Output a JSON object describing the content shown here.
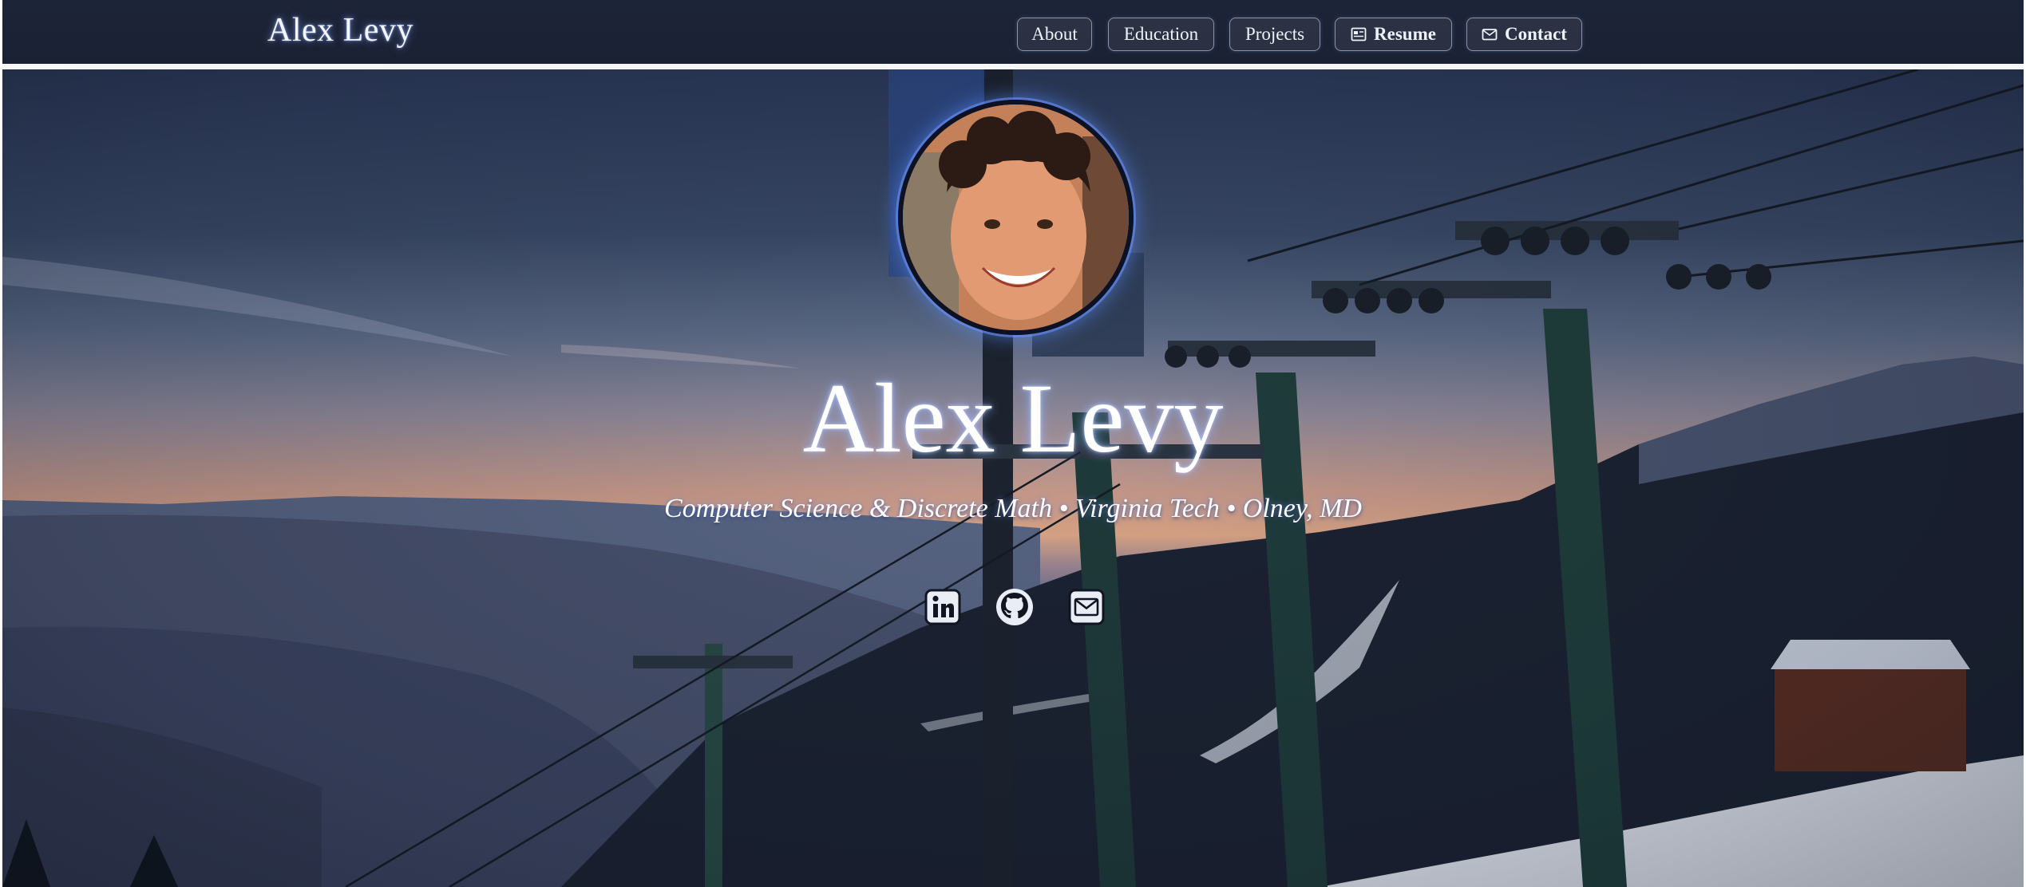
{
  "nav": {
    "brand": "Alex Levy",
    "links": [
      {
        "label": "About",
        "icon": null
      },
      {
        "label": "Education",
        "icon": null
      },
      {
        "label": "Projects",
        "icon": null
      },
      {
        "label": "Resume",
        "icon": "pdf-icon"
      },
      {
        "label": "Contact",
        "icon": "mail-icon"
      }
    ]
  },
  "hero": {
    "name": "Alex Levy",
    "tagline": "Computer Science & Discrete Math • Virginia Tech • Olney, MD",
    "avatar_alt": "Profile photo",
    "socials": [
      {
        "name": "LinkedIn",
        "icon": "linkedin-icon"
      },
      {
        "name": "GitHub",
        "icon": "github-icon"
      },
      {
        "name": "Email",
        "icon": "email-icon"
      }
    ]
  },
  "colors": {
    "nav_bg": "#1d2438",
    "glow": "#6e96ff",
    "text": "#ffffff"
  }
}
